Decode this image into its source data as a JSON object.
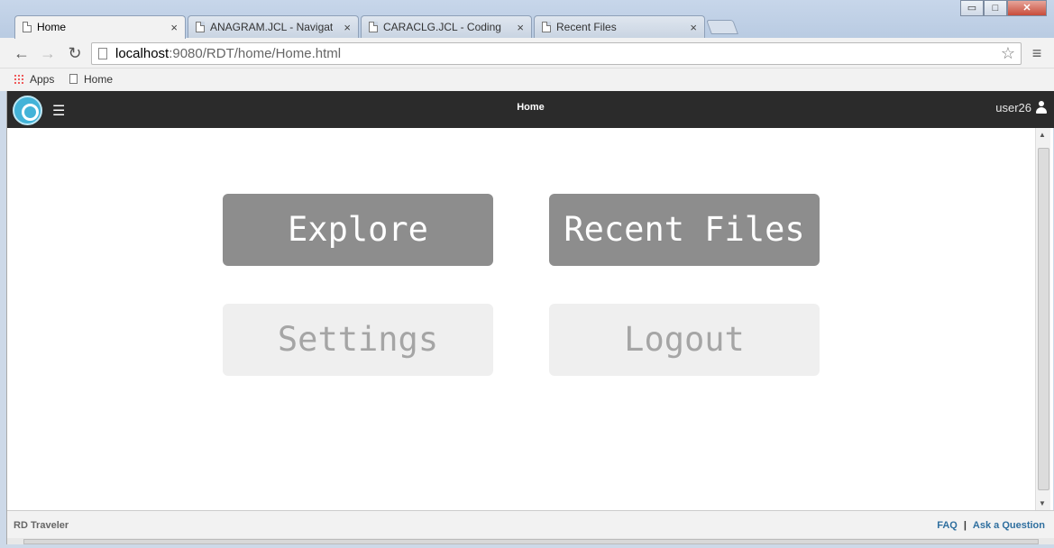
{
  "browser": {
    "tabs": [
      {
        "label": "Home",
        "active": true
      },
      {
        "label": "ANAGRAM.JCL - Navigato",
        "active": false
      },
      {
        "label": "CARACLG.JCL - Coding",
        "active": false
      },
      {
        "label": "Recent Files",
        "active": false
      }
    ],
    "url_host": "localhost",
    "url_path": ":9080/RDT/home/Home.html",
    "bookmarks": {
      "apps": "Apps",
      "home": "Home"
    },
    "window_buttons": {
      "minimize": "▭",
      "maximize": "□",
      "close": "✕"
    }
  },
  "app": {
    "title": "Home",
    "user": "user26",
    "tiles": {
      "explore": "Explore",
      "recent": "Recent Files",
      "settings": "Settings",
      "logout": "Logout"
    },
    "footer": {
      "brand": "RD Traveler",
      "faq": "FAQ",
      "separator": "|",
      "ask": "Ask a Question"
    }
  },
  "colors": {
    "appbar": "#2b2b2b",
    "tile_dark": "#8d8d8d",
    "tile_light": "#efefef",
    "link": "#2f6f9f",
    "logo": "#43b3d8"
  },
  "icons": [
    "back-icon",
    "forward-icon",
    "reload-icon",
    "star-icon",
    "chrome-menu-icon",
    "logo-icon",
    "hamburger-icon",
    "user-icon"
  ]
}
